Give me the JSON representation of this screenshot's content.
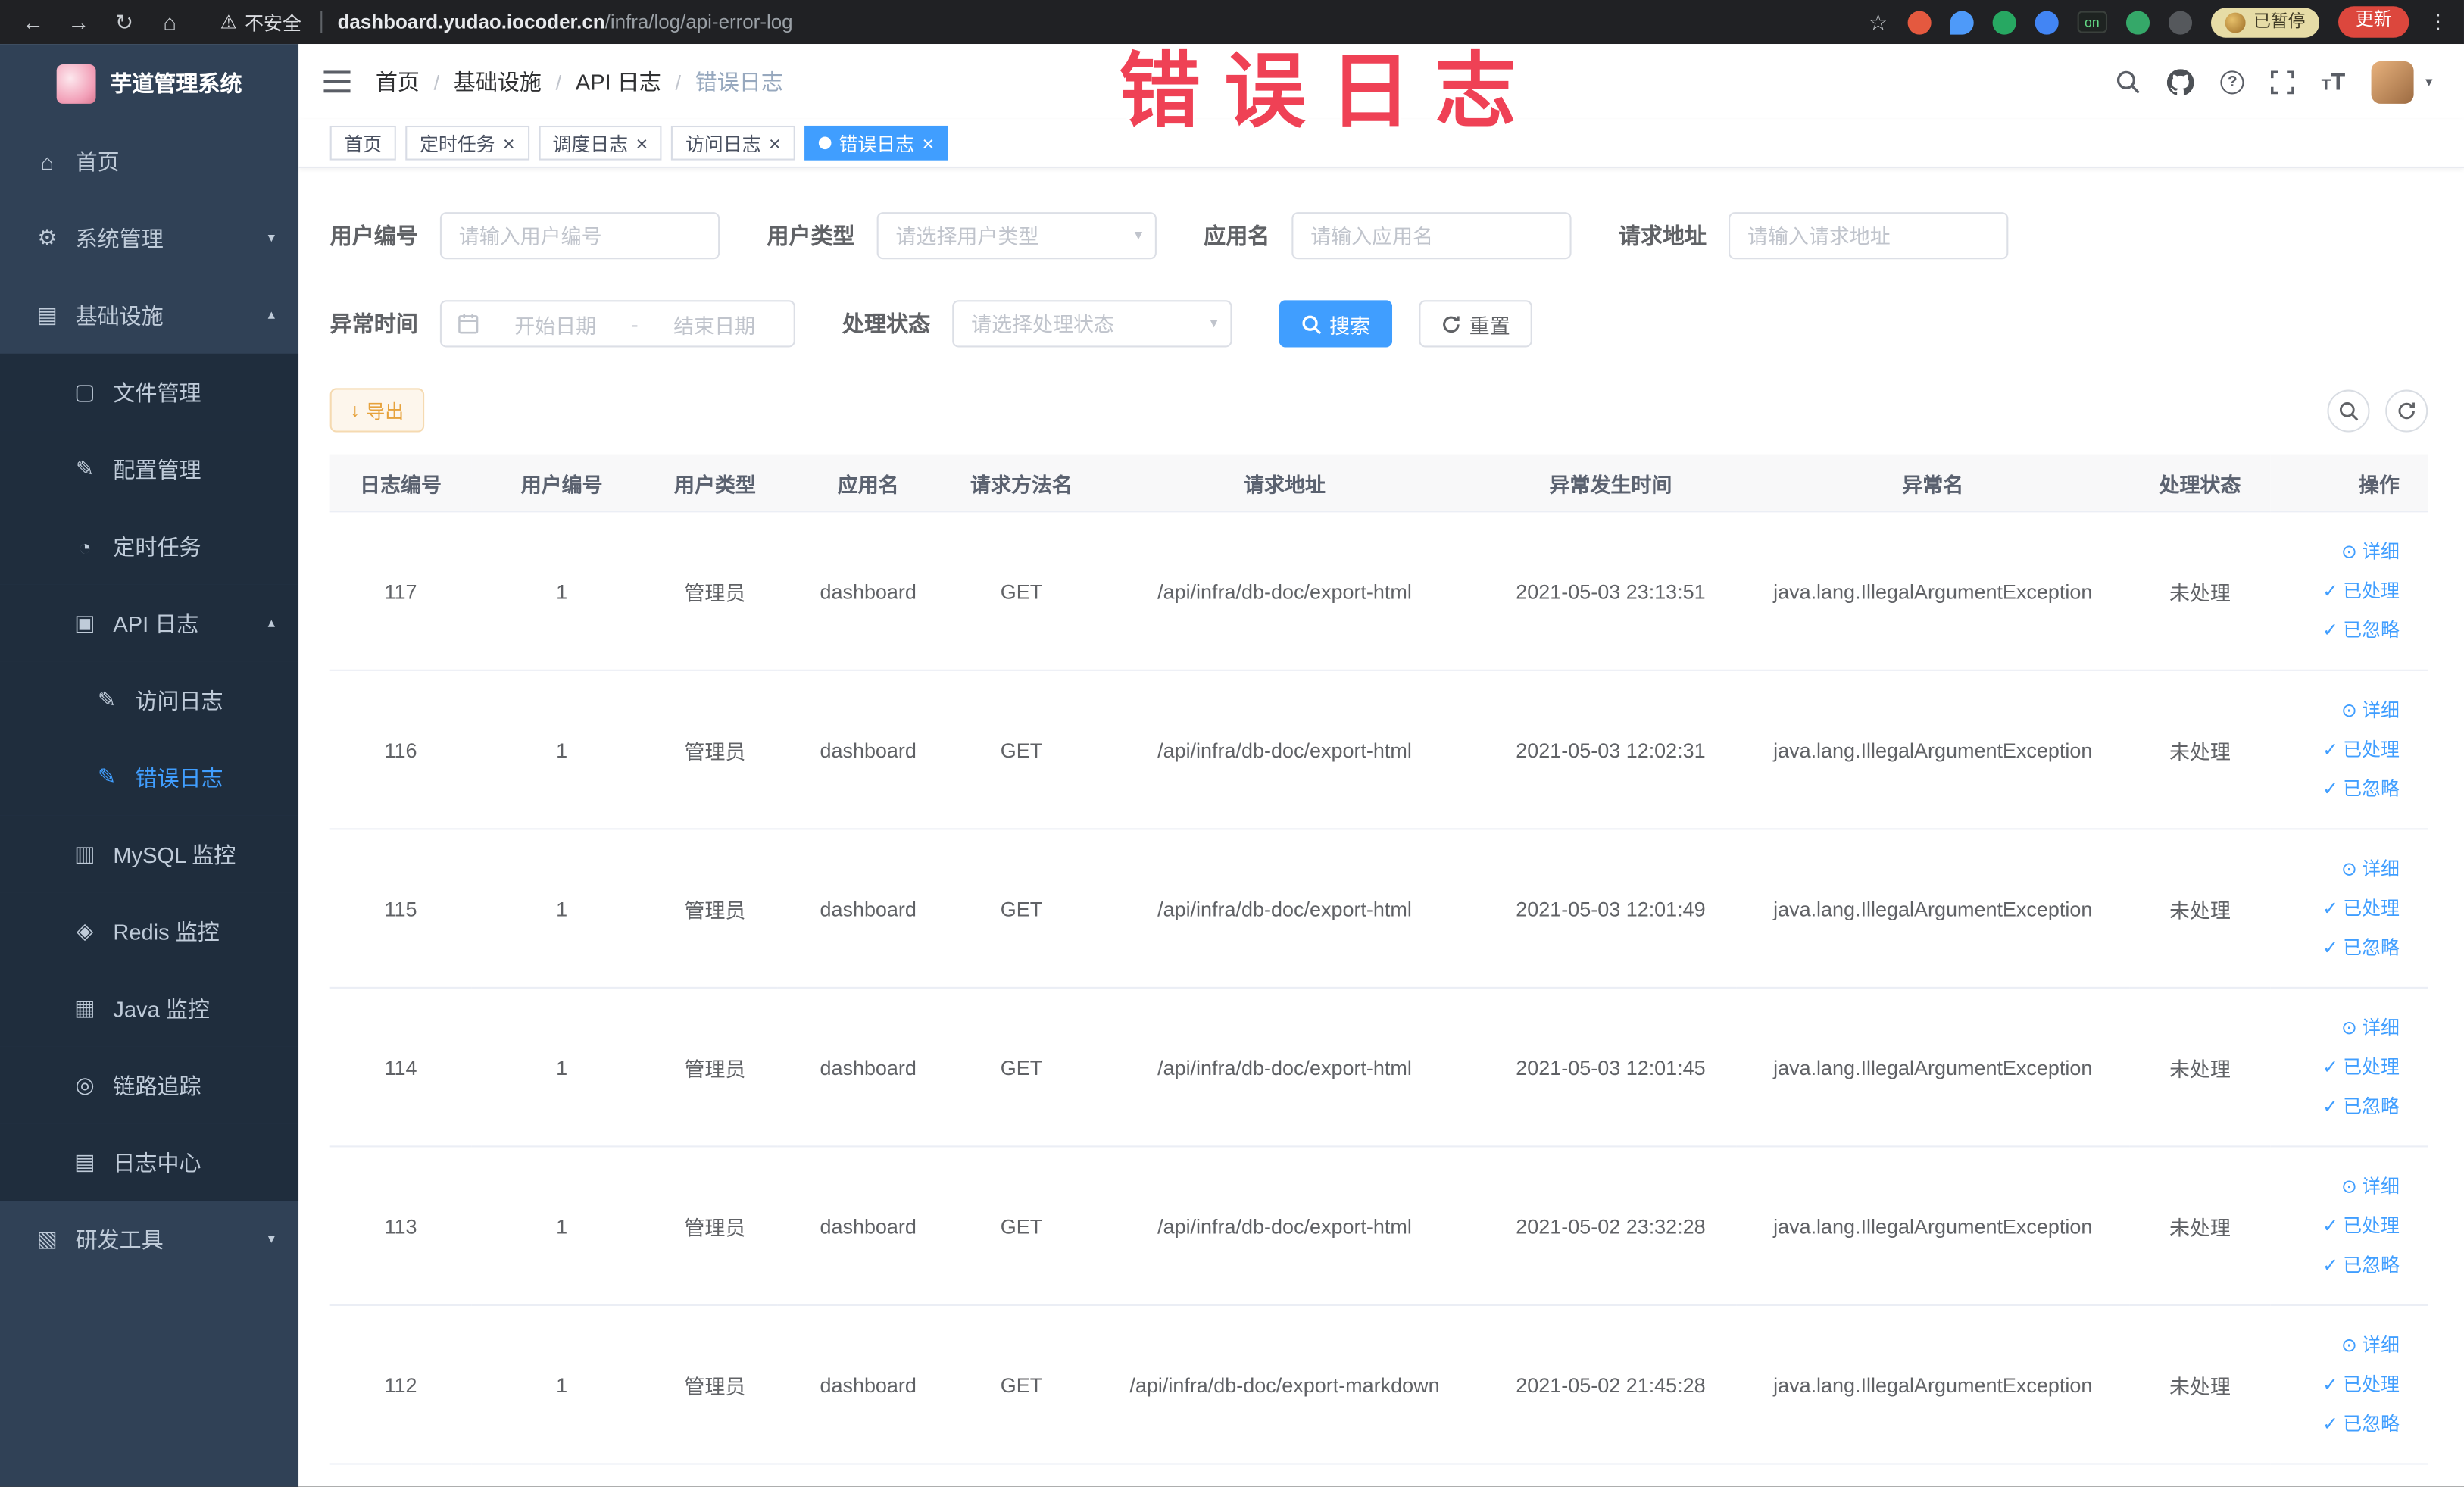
{
  "browser": {
    "security_label": "不安全",
    "url_domain": "dashboard.yudao.iocoder.cn",
    "url_path": "/infra/log/api-error-log",
    "on_badge": "on",
    "paused_badge": "已暂停",
    "update_label": "更新"
  },
  "annotation": {
    "text": "错误日志",
    "color": "#ef4155"
  },
  "colors": {
    "accent": "#409eff",
    "sidebar_bg": "#304156",
    "submenu_bg": "#1f2d3d",
    "warning": "#e6a23c"
  },
  "icons": {
    "back": "←",
    "forward": "→",
    "reload": "↻",
    "home": "⌂",
    "warning": "⚠",
    "star": "☆",
    "kebab": "⋮",
    "menu_home": "⌂",
    "menu_system": "⚙",
    "menu_infra": "▤",
    "menu_file": "▢",
    "menu_config": "✎",
    "menu_job": "◔",
    "menu_api_log": "▣",
    "menu_access_log": "✎",
    "menu_error_log": "✎",
    "menu_mysql": "▥",
    "menu_redis": "◈",
    "menu_java": "▦",
    "menu_trace": "◎",
    "menu_log_center": "▤",
    "menu_devtools": "▧",
    "chevron_down": "▾",
    "chevron_up": "▴",
    "close": "×",
    "eye": "⊙",
    "check": "✓",
    "download": "↓",
    "question": "?",
    "caret_down": "▾",
    "font_size_big": "T",
    "font_size_small": "T",
    "range_separator_icon": ""
  },
  "sidebar": {
    "title": "芋道管理系统",
    "items": [
      {
        "label": "首页"
      },
      {
        "label": "系统管理"
      },
      {
        "label": "基础设施"
      },
      {
        "label": "文件管理"
      },
      {
        "label": "配置管理"
      },
      {
        "label": "定时任务"
      },
      {
        "label": "API 日志"
      },
      {
        "label": "访问日志"
      },
      {
        "label": "错误日志",
        "active": true
      },
      {
        "label": "MySQL 监控"
      },
      {
        "label": "Redis 监控"
      },
      {
        "label": "Java 监控"
      },
      {
        "label": "链路追踪"
      },
      {
        "label": "日志中心"
      },
      {
        "label": "研发工具"
      }
    ]
  },
  "breadcrumb": {
    "items": [
      "首页",
      "基础设施",
      "API 日志",
      "错误日志"
    ]
  },
  "tabs": [
    {
      "label": "首页",
      "closable": false,
      "active": false
    },
    {
      "label": "定时任务",
      "closable": true,
      "active": false
    },
    {
      "label": "调度日志",
      "closable": true,
      "active": false
    },
    {
      "label": "访问日志",
      "closable": true,
      "active": false
    },
    {
      "label": "错误日志",
      "closable": true,
      "active": true
    }
  ],
  "filters": {
    "user_id": {
      "label": "用户编号",
      "placeholder": "请输入用户编号"
    },
    "user_type": {
      "label": "用户类型",
      "placeholder": "请选择用户类型"
    },
    "app_name": {
      "label": "应用名",
      "placeholder": "请输入应用名"
    },
    "request_url": {
      "label": "请求地址",
      "placeholder": "请输入请求地址"
    },
    "exception_time": {
      "label": "异常时间",
      "start_placeholder": "开始日期",
      "separator": "-",
      "end_placeholder": "结束日期"
    },
    "process_status": {
      "label": "处理状态",
      "placeholder": "请选择处理状态"
    },
    "search_button": "搜索",
    "reset_button": "重置"
  },
  "toolbar": {
    "export_button": "导出"
  },
  "table": {
    "headers": [
      "日志编号",
      "用户编号",
      "用户类型",
      "应用名",
      "请求方法名",
      "请求地址",
      "异常发生时间",
      "异常名",
      "处理状态",
      "操作"
    ],
    "action_labels": {
      "detail": "详细",
      "process": "已处理",
      "ignore": "已忽略"
    },
    "rows": [
      {
        "id": "117",
        "user_id": "1",
        "user_type": "管理员",
        "app": "dashboard",
        "method": "GET",
        "url": "/api/infra/db-doc/export-html",
        "time": "2021-05-03 23:13:51",
        "exception": "java.lang.IllegalArgumentException",
        "status": "未处理"
      },
      {
        "id": "116",
        "user_id": "1",
        "user_type": "管理员",
        "app": "dashboard",
        "method": "GET",
        "url": "/api/infra/db-doc/export-html",
        "time": "2021-05-03 12:02:31",
        "exception": "java.lang.IllegalArgumentException",
        "status": "未处理"
      },
      {
        "id": "115",
        "user_id": "1",
        "user_type": "管理员",
        "app": "dashboard",
        "method": "GET",
        "url": "/api/infra/db-doc/export-html",
        "time": "2021-05-03 12:01:49",
        "exception": "java.lang.IllegalArgumentException",
        "status": "未处理"
      },
      {
        "id": "114",
        "user_id": "1",
        "user_type": "管理员",
        "app": "dashboard",
        "method": "GET",
        "url": "/api/infra/db-doc/export-html",
        "time": "2021-05-03 12:01:45",
        "exception": "java.lang.IllegalArgumentException",
        "status": "未处理"
      },
      {
        "id": "113",
        "user_id": "1",
        "user_type": "管理员",
        "app": "dashboard",
        "method": "GET",
        "url": "/api/infra/db-doc/export-html",
        "time": "2021-05-02 23:32:28",
        "exception": "java.lang.IllegalArgumentException",
        "status": "未处理"
      },
      {
        "id": "112",
        "user_id": "1",
        "user_type": "管理员",
        "app": "dashboard",
        "method": "GET",
        "url": "/api/infra/db-doc/export-markdown",
        "time": "2021-05-02 21:45:28",
        "exception": "java.lang.IllegalArgumentException",
        "status": "未处理"
      }
    ]
  }
}
